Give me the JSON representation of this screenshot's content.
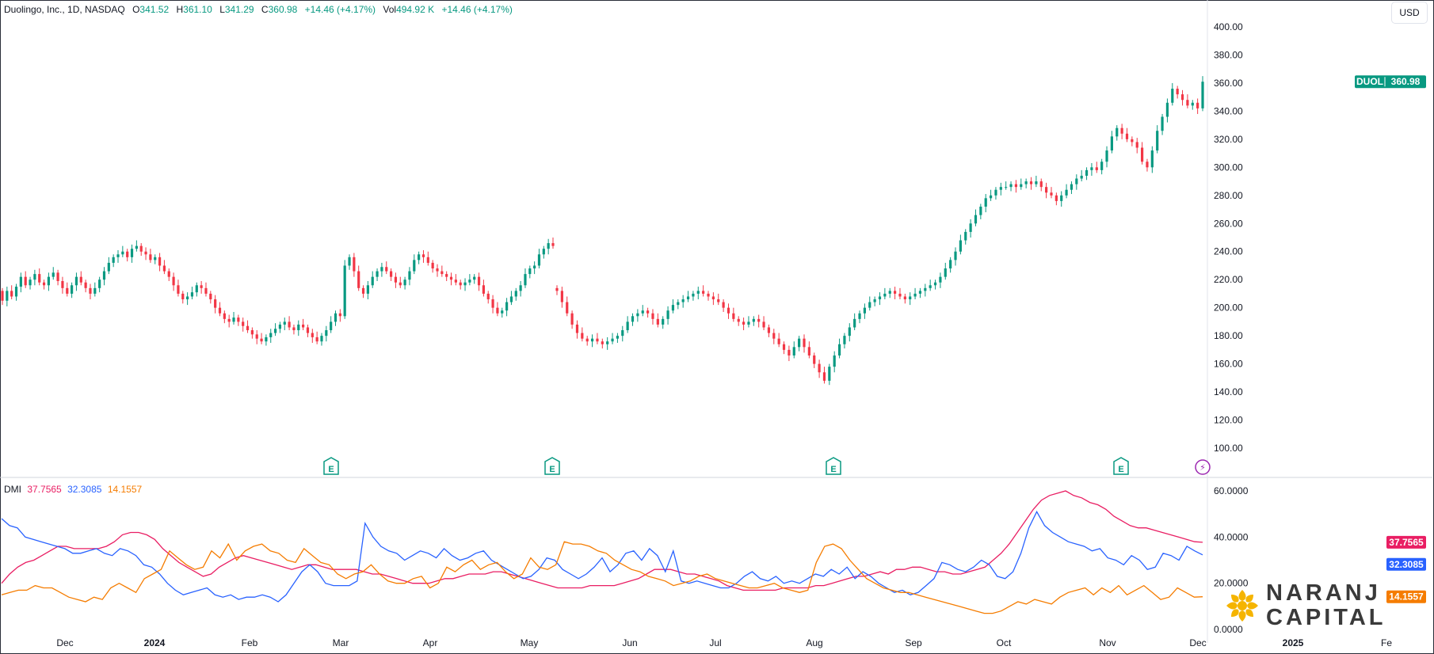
{
  "header": {
    "symbol_text": "Duolingo, Inc., 1D, NASDAQ",
    "o_key": "O",
    "o_val": "341.52",
    "h_key": "H",
    "h_val": "361.10",
    "l_key": "L",
    "l_val": "341.29",
    "c_key": "C",
    "c_val": "360.98",
    "change": "+14.46 (+4.17%)",
    "vol_key": "Vol",
    "vol_val": "494.92 K",
    "vol_change": "+14.46 (+4.17%)"
  },
  "currency_button": "USD",
  "price_tag": {
    "symbol": "DUOL",
    "value": "360.98",
    "color": "#089981"
  },
  "dmi": {
    "label": "DMI",
    "adx": {
      "value": "37.7565",
      "color": "#e91e63"
    },
    "plus_di": {
      "value": "32.3085",
      "color": "#2962ff"
    },
    "minus_di": {
      "value": "14.1557",
      "color": "#f57c00"
    }
  },
  "events": [
    {
      "label": "E",
      "date": "2024-02-28",
      "kind": "earnings"
    },
    {
      "label": "E",
      "date": "2024-05-08",
      "kind": "earnings"
    },
    {
      "label": "E",
      "date": "2024-08-07",
      "kind": "earnings"
    },
    {
      "label": "E",
      "date": "2024-11-06",
      "kind": "earnings"
    },
    {
      "label": "⚡",
      "date": "2024-12-02",
      "kind": "split-dividend"
    }
  ],
  "brand": {
    "line1": "NARANJ",
    "line2": "CAPITAL",
    "logo_color": "#f5b400"
  },
  "chart_data": [
    {
      "type": "candlestick",
      "title": "Duolingo, Inc., 1D, NASDAQ",
      "ylim": [
        90,
        410
      ],
      "y_ticks": [
        "400.00",
        "380.00",
        "360.00",
        "340.00",
        "320.00",
        "300.00",
        "280.00",
        "260.00",
        "240.00",
        "220.00",
        "200.00",
        "180.00",
        "160.00",
        "140.00",
        "120.00",
        "100.00"
      ],
      "x_ticks": [
        "Dec",
        "2024",
        "Feb",
        "Mar",
        "Apr",
        "May",
        "Jun",
        "Jul",
        "Aug",
        "Sep",
        "Oct",
        "Nov",
        "Dec",
        "2025",
        "Fe"
      ],
      "up_color": "#089981",
      "down_color": "#f23645",
      "series": [
        {
          "name": "DUOL",
          "close": [
            205,
            212,
            208,
            215,
            222,
            216,
            220,
            224,
            218,
            216,
            222,
            225,
            219,
            214,
            210,
            216,
            222,
            218,
            214,
            210,
            214,
            220,
            226,
            232,
            236,
            238,
            240,
            236,
            242,
            244,
            240,
            238,
            234,
            236,
            230,
            226,
            222,
            216,
            210,
            206,
            208,
            211,
            216,
            214,
            210,
            206,
            200,
            196,
            192,
            190,
            193,
            190,
            187,
            184,
            181,
            178,
            176,
            179,
            182,
            185,
            188,
            190,
            186,
            184,
            188,
            186,
            182,
            179,
            176,
            180,
            184,
            190,
            196,
            194,
            230,
            236,
            226,
            214,
            210,
            216,
            222,
            226,
            229,
            226,
            222,
            218,
            216,
            220,
            226,
            234,
            238,
            236,
            232,
            228,
            226,
            224,
            222,
            220,
            218,
            216,
            218,
            220,
            222,
            216,
            210,
            206,
            200,
            196,
            198,
            204,
            208,
            212,
            216,
            224,
            228,
            230,
            238,
            242,
            246,
            244
          ],
          "gap_then": [
            212,
            204,
            196,
            188,
            182,
            178,
            176,
            178,
            176,
            174,
            176,
            178,
            180,
            184,
            190,
            194,
            196,
            198,
            196,
            192,
            188,
            192,
            198,
            202,
            204,
            206,
            208,
            210,
            212,
            210,
            208,
            206,
            204,
            200,
            196,
            192,
            190,
            188,
            190,
            192,
            190,
            186,
            182,
            178,
            174,
            170,
            166,
            172,
            178,
            172,
            166,
            160,
            154,
            148,
            158,
            166,
            174,
            180,
            186,
            192,
            196,
            200,
            204,
            206,
            208,
            210,
            212,
            210,
            208,
            206,
            208,
            210,
            212,
            214,
            216,
            218,
            222,
            228,
            234,
            240,
            248,
            254,
            260,
            266,
            272,
            278,
            280,
            284,
            286,
            286,
            288,
            286,
            288,
            290,
            288,
            290,
            286,
            282,
            280,
            276,
            280,
            284,
            288,
            292,
            294,
            298,
            300,
            298,
            304,
            312,
            322,
            328,
            324,
            320,
            318,
            314,
            304,
            300,
            312,
            326,
            336,
            346,
            356,
            352,
            348,
            344,
            346,
            342,
            360.98
          ]
        }
      ]
    },
    {
      "type": "line",
      "title": "DMI",
      "ylim": [
        0,
        62
      ],
      "y_ticks": [
        "60.0000",
        "40.0000",
        "20.0000",
        "0.0000"
      ],
      "series": [
        {
          "name": "ADX",
          "color": "#e91e63",
          "last": 37.7565,
          "values": [
            20,
            24,
            27,
            29,
            30,
            32,
            34,
            36,
            36,
            35,
            35,
            35,
            35,
            36,
            38,
            41,
            42,
            42,
            41,
            39,
            35,
            32,
            29,
            27,
            25,
            23,
            24,
            27,
            29,
            31,
            32,
            31,
            30,
            29,
            28,
            27,
            26,
            27,
            28,
            28,
            27,
            26,
            26,
            26,
            26,
            25,
            24,
            24,
            23,
            22,
            21,
            20,
            20,
            20,
            21,
            22,
            22,
            23,
            24,
            24,
            24,
            25,
            25,
            24,
            23,
            22,
            21,
            20,
            19,
            18,
            18,
            18,
            18,
            19,
            19,
            19,
            19,
            20,
            21,
            22,
            24,
            26,
            26,
            26,
            25,
            24,
            24,
            23,
            22,
            21,
            19,
            18,
            17,
            17,
            17,
            17,
            17,
            18,
            18,
            18,
            18,
            19,
            19,
            20,
            21,
            22,
            23,
            23,
            24,
            25,
            24,
            26,
            26,
            27,
            27,
            26,
            25,
            25,
            24,
            24,
            25,
            26,
            27,
            30,
            33,
            37,
            42,
            47,
            52,
            56,
            58,
            59,
            60,
            58,
            57,
            55,
            54,
            52,
            49,
            47,
            45,
            44,
            44,
            43,
            42,
            41,
            40,
            39,
            38,
            37.76
          ]
        },
        {
          "name": "+DI",
          "color": "#2962ff",
          "last": 32.3085,
          "values": [
            48,
            45,
            44,
            40,
            39,
            38,
            37,
            36,
            35,
            33,
            33,
            34,
            35,
            33,
            32,
            35,
            34,
            32,
            28,
            27,
            24,
            20,
            17,
            15,
            16,
            17,
            18,
            15,
            14,
            15,
            13,
            14,
            14,
            15,
            14,
            12,
            15,
            20,
            25,
            28,
            25,
            20,
            19,
            19,
            19,
            21,
            46,
            40,
            36,
            34,
            33,
            30,
            32,
            34,
            33,
            31,
            35,
            32,
            30,
            31,
            33,
            34,
            30,
            28,
            26,
            24,
            22,
            23,
            26,
            31,
            30,
            26,
            24,
            22,
            24,
            27,
            31,
            25,
            28,
            33,
            34,
            30,
            35,
            32,
            25,
            34,
            21,
            20,
            21,
            20,
            19,
            18,
            18,
            20,
            23,
            25,
            22,
            21,
            23,
            20,
            21,
            20,
            22,
            24,
            23,
            26,
            24,
            27,
            22,
            25,
            23,
            20,
            18,
            16,
            17,
            15,
            16,
            19,
            22,
            29,
            28,
            26,
            25,
            27,
            30,
            28,
            23,
            22,
            25,
            33,
            44,
            51,
            45,
            42,
            40,
            38,
            37,
            36,
            34,
            35,
            31,
            30,
            28,
            32,
            30,
            26,
            27,
            33,
            32,
            30,
            36,
            34,
            32.31
          ]
        },
        {
          "name": "-DI",
          "color": "#f57c00",
          "last": 14.1557,
          "values": [
            15,
            16,
            17,
            17,
            19,
            18,
            18,
            16,
            14,
            13,
            12,
            14,
            13,
            18,
            20,
            18,
            16,
            22,
            24,
            26,
            34,
            31,
            28,
            26,
            27,
            34,
            31,
            37,
            30,
            34,
            36,
            37,
            34,
            33,
            30,
            29,
            35,
            32,
            29,
            28,
            24,
            22,
            24,
            25,
            28,
            24,
            21,
            20,
            20,
            22,
            23,
            18,
            20,
            27,
            25,
            28,
            30,
            26,
            28,
            29,
            25,
            22,
            24,
            31,
            27,
            26,
            28,
            38,
            37,
            37,
            36,
            34,
            33,
            30,
            28,
            26,
            25,
            23,
            22,
            21,
            19,
            20,
            21,
            23,
            24,
            22,
            21,
            20,
            19,
            18,
            18,
            19,
            20,
            18,
            17,
            16,
            17,
            29,
            36,
            37,
            35,
            30,
            26,
            22,
            20,
            18,
            17,
            16,
            16,
            15,
            14,
            13,
            12,
            11,
            10,
            9,
            8,
            7,
            7,
            8,
            10,
            12,
            11,
            13,
            12,
            11,
            14,
            16,
            17,
            18,
            15,
            18,
            16,
            19,
            15,
            17,
            19,
            16,
            13,
            14,
            18,
            16,
            14,
            14.16
          ]
        }
      ]
    }
  ]
}
